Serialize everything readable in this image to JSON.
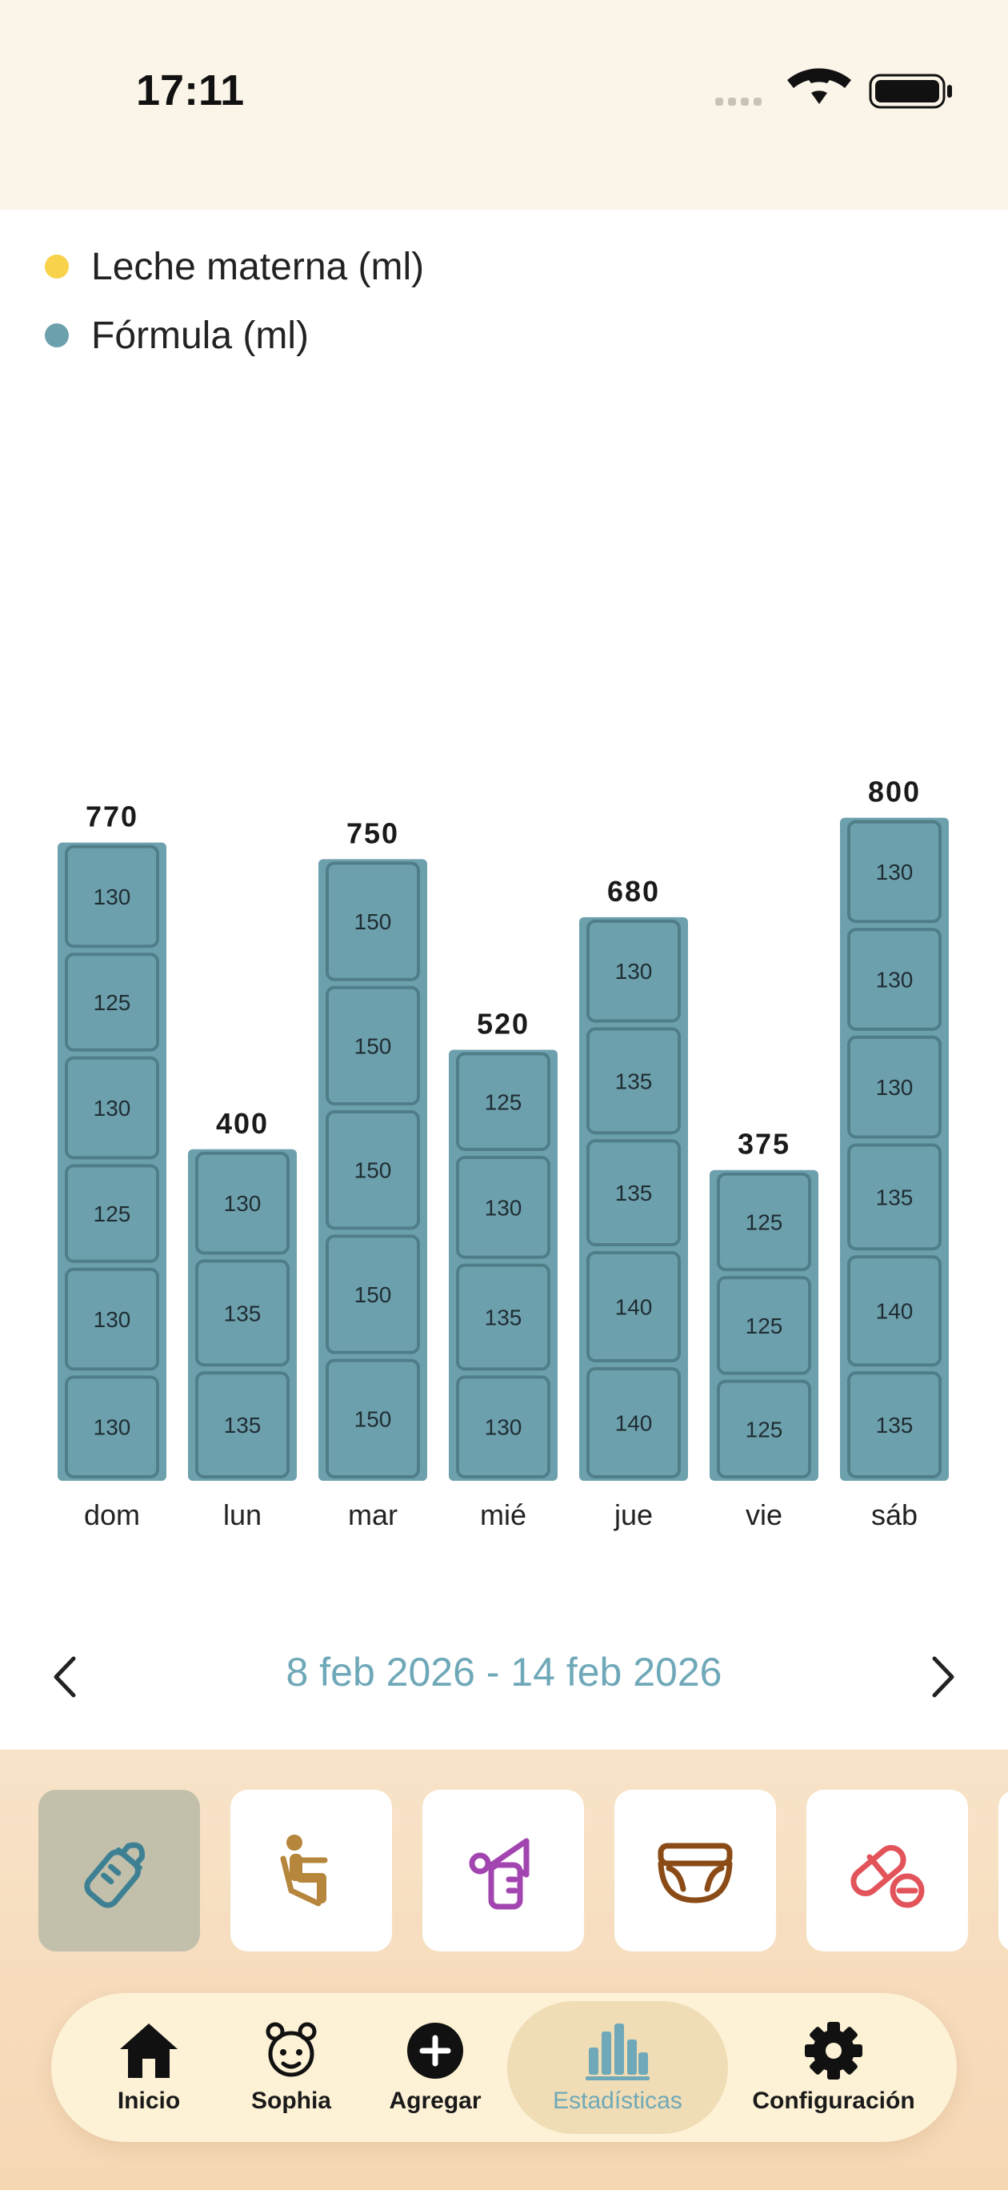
{
  "status_bar": {
    "time": "17:11"
  },
  "legend": [
    {
      "label": "Leche materna (ml)",
      "color": "#f7d24a"
    },
    {
      "label": "Fórmula (ml)",
      "color": "#6da0ad"
    }
  ],
  "chart_data": {
    "type": "bar",
    "stacked": true,
    "categories": [
      "dom",
      "lun",
      "mar",
      "mié",
      "jue",
      "vie",
      "sáb"
    ],
    "series": [
      {
        "name": "Leche materna (ml)",
        "values": [
          0,
          0,
          0,
          0,
          0,
          0,
          0
        ]
      },
      {
        "name": "Fórmula (ml)",
        "values": [
          770,
          400,
          750,
          520,
          680,
          375,
          800
        ]
      }
    ],
    "totals": [
      770,
      400,
      750,
      520,
      680,
      375,
      800
    ],
    "segments": [
      [
        130,
        130,
        125,
        130,
        125,
        130
      ],
      [
        135,
        135,
        130
      ],
      [
        150,
        150,
        150,
        150,
        150
      ],
      [
        130,
        135,
        130,
        125
      ],
      [
        140,
        140,
        135,
        135,
        130
      ],
      [
        125,
        125,
        125
      ],
      [
        135,
        140,
        135,
        130,
        130,
        130
      ]
    ],
    "colors": {
      "bar": "#6da0ad",
      "segment_border": "#4f7e89"
    }
  },
  "date_range": {
    "label": "8 feb 2026 - 14 feb 2026"
  },
  "categories": [
    {
      "icon": "baby-bottle-icon",
      "color": "#3e8093",
      "selected": true
    },
    {
      "icon": "sleeping-icon",
      "color": "#b5863c",
      "selected": false
    },
    {
      "icon": "breast-pump-icon",
      "color": "#a345b0",
      "selected": false
    },
    {
      "icon": "diaper-icon",
      "color": "#8a4b16",
      "selected": false
    },
    {
      "icon": "medicine-icon",
      "color": "#e2535a",
      "selected": false
    }
  ],
  "tabs": [
    {
      "label": "Inicio",
      "icon": "home-icon"
    },
    {
      "label": "Sophia",
      "icon": "baby-face-icon"
    },
    {
      "label": "Agregar",
      "icon": "add-circle-icon"
    },
    {
      "label": "Estadísticas",
      "icon": "bar-chart-icon",
      "active": true
    },
    {
      "label": "Configuración",
      "icon": "gear-icon"
    }
  ],
  "accent_color": "#6fa8b8"
}
